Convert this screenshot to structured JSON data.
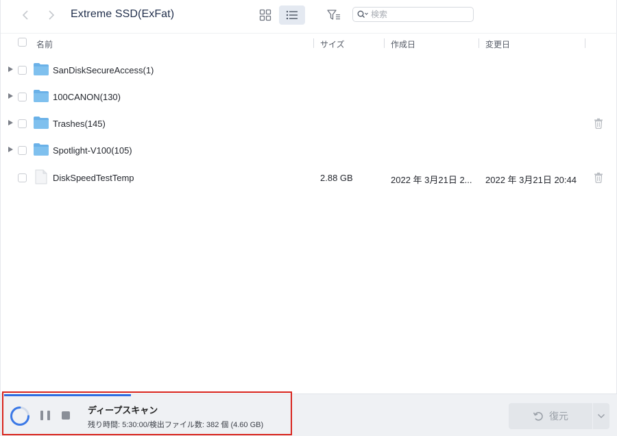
{
  "toolbar": {
    "title": "Extreme SSD(ExFat)",
    "search_placeholder": "検索"
  },
  "table": {
    "columns": {
      "name": "名前",
      "size": "サイズ",
      "created": "作成日",
      "modified": "変更日"
    },
    "rows": [
      {
        "name": "SanDiskSecureAccess(1)",
        "size": "",
        "created": "",
        "modified": "",
        "type": "folder"
      },
      {
        "name": "100CANON(130)",
        "size": "",
        "created": "",
        "modified": "",
        "type": "folder"
      },
      {
        "name": "Trashes(145)",
        "size": "",
        "created": "",
        "modified": "",
        "type": "folder"
      },
      {
        "name": "Spotlight-V100(105)",
        "size": "",
        "created": "",
        "modified": "",
        "type": "folder"
      },
      {
        "name": "DiskSpeedTestTemp",
        "size": "2.88 GB",
        "created": "2022 年 3月21日 2...",
        "modified": "2022 年 3月21日 20:44",
        "type": "file"
      }
    ]
  },
  "scan": {
    "title": "ディープスキャン",
    "status": "残り時間: 5:30:00/検出ファイル数: 382 個 (4.60 GB)",
    "progress": 0.44
  },
  "actions": {
    "recover_label": "復元"
  },
  "colors": {
    "accent": "#2f6de1",
    "folder": "#6ab1e8",
    "highlight": "#d8231c"
  }
}
